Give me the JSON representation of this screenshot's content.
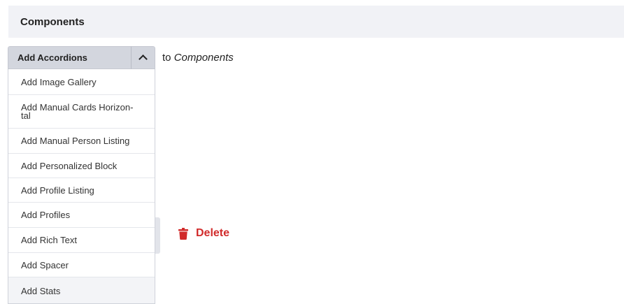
{
  "header": {
    "title": "Components"
  },
  "add_button": {
    "label": "Add Accordions"
  },
  "target": {
    "prefix": "to",
    "name": "Components"
  },
  "menu": {
    "items": [
      {
        "label": "Add Image Gallery"
      },
      {
        "label": "Add Manual Cards Horizon-\ntal"
      },
      {
        "label": "Add Manual Person Listing"
      },
      {
        "label": "Add Personalized Block"
      },
      {
        "label": "Add Profile Listing"
      },
      {
        "label": "Add Profiles"
      },
      {
        "label": "Add Rich Text"
      },
      {
        "label": "Add Spacer"
      },
      {
        "label": "Add Stats"
      }
    ]
  },
  "delete": {
    "label": "Delete"
  },
  "icons": {
    "chevron": "chevron-up-icon",
    "delete": "trash-icon"
  },
  "colors": {
    "delete": "#d12b2b",
    "header_bg": "#f1f2f6",
    "button_bg": "#d3d6de"
  }
}
